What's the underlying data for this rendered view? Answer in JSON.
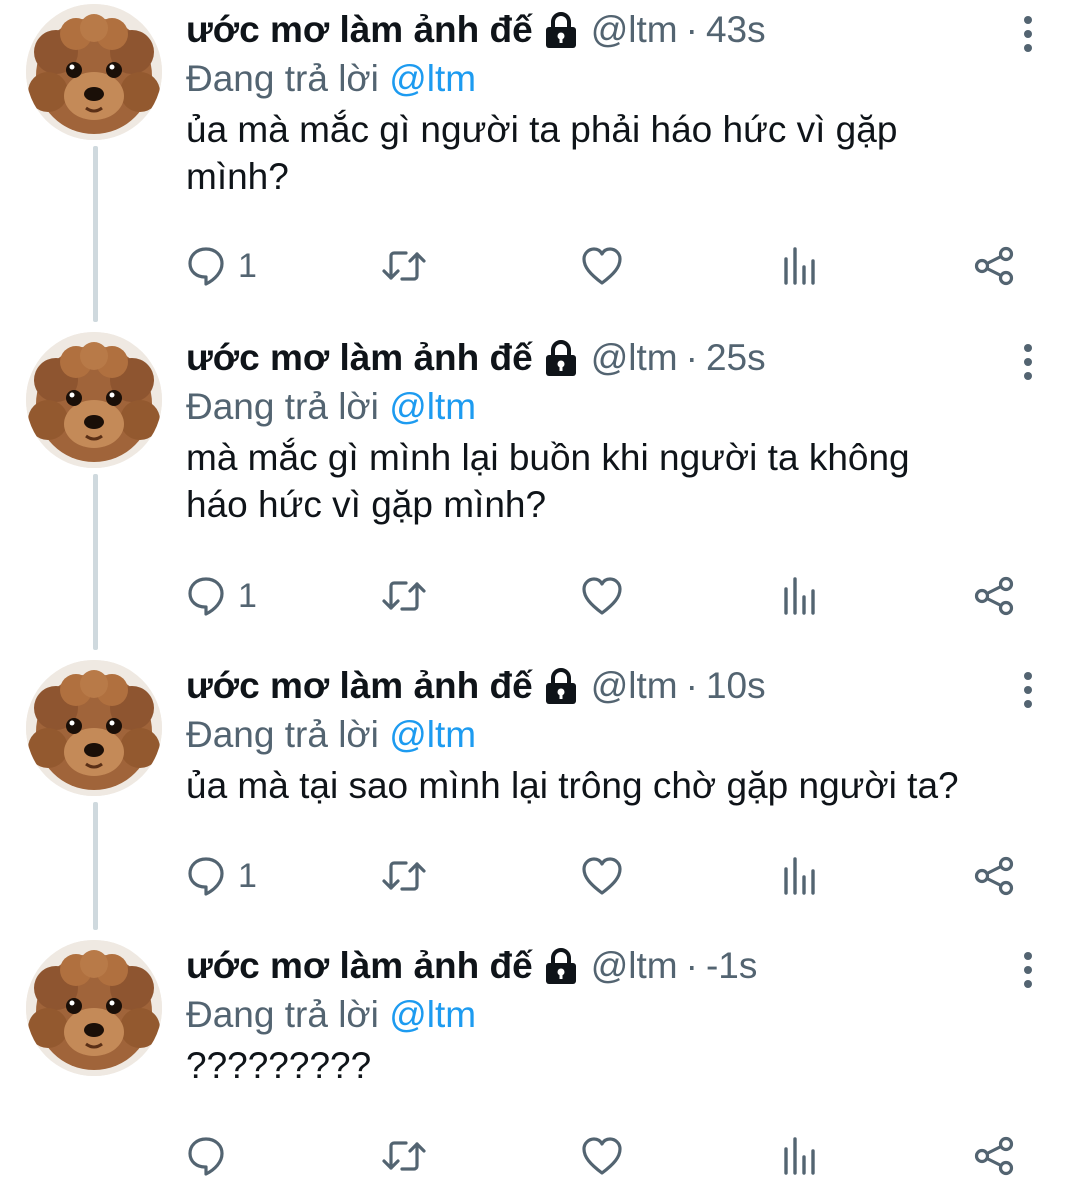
{
  "colors": {
    "text": "#0f1419",
    "secondary": "#536471",
    "accent": "#1d9bf0",
    "thread_line": "#cfd9de"
  },
  "tweets": [
    {
      "name": "ước mơ làm ảnh đế",
      "handle": "@ltm",
      "separator": "·",
      "time": "43s",
      "replying_prefix": "Đang trả lời",
      "replying_to": "@ltm",
      "text": "ủa mà mắc gì người ta phải háo hức vì gặp\nmình?",
      "reply_count": "1"
    },
    {
      "name": "ước mơ làm ảnh đế",
      "handle": "@ltm",
      "separator": "·",
      "time": "25s",
      "replying_prefix": "Đang trả lời",
      "replying_to": "@ltm",
      "text": "mà mắc gì mình lại buồn khi người ta không\nháo hức vì gặp mình?",
      "reply_count": "1"
    },
    {
      "name": "ước mơ làm ảnh đế",
      "handle": "@ltm",
      "separator": "·",
      "time": "10s",
      "replying_prefix": "Đang trả lời",
      "replying_to": "@ltm",
      "text": "ủa mà tại sao mình lại trông chờ gặp người ta?",
      "reply_count": "1"
    },
    {
      "name": "ước mơ làm ảnh đế",
      "handle": "@ltm",
      "separator": "·",
      "time": "-1s",
      "replying_prefix": "Đang trả lời",
      "replying_to": "@ltm",
      "text": "?????????",
      "reply_count": ""
    }
  ]
}
